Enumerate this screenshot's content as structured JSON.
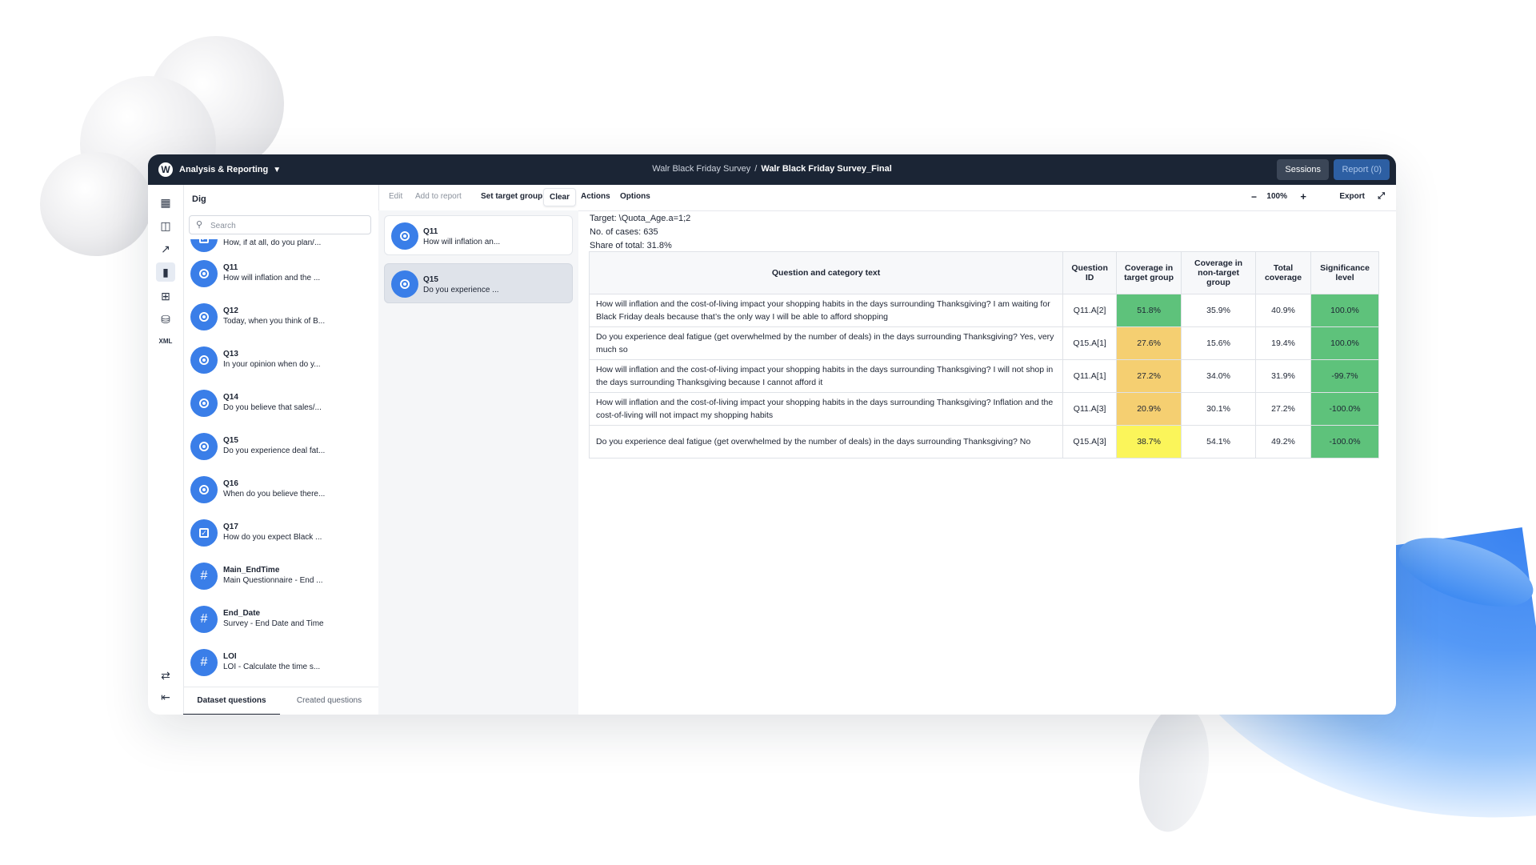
{
  "colors": {
    "topbar_bg": "#1b2535",
    "accent_blue": "#3a7ee8",
    "green": "#5ec27b",
    "orange": "#f5cf71",
    "yellow": "#fbf55a"
  },
  "header": {
    "app_title": "Analysis & Reporting",
    "breadcrumb_parent": "Walr Black Friday Survey",
    "breadcrumb_separator": "/",
    "breadcrumb_current": "Walr Black Friday Survey_Final",
    "sessions_label": "Sessions",
    "report_label": "Report (0)"
  },
  "rail_icons": [
    "table-icon",
    "layout-icon",
    "line-chart-icon",
    "bar-chart-icon",
    "grid-icon",
    "database-icon",
    "xml-icon",
    "automation-icon",
    "collapse-icon"
  ],
  "question_panel": {
    "title": "Dig",
    "search_placeholder": "Search",
    "items": [
      {
        "name": "",
        "desc": "How, if at all, do you plan/...",
        "icon": "checkbox-icon"
      },
      {
        "name": "Q11",
        "desc": "How will inflation and the ...",
        "icon": "radio-icon"
      },
      {
        "name": "Q12",
        "desc": "Today, when you think of B...",
        "icon": "radio-icon"
      },
      {
        "name": "Q13",
        "desc": "In your opinion when do y...",
        "icon": "radio-icon"
      },
      {
        "name": "Q14",
        "desc": "Do you believe that sales/...",
        "icon": "radio-icon"
      },
      {
        "name": "Q15",
        "desc": "Do you experience deal fat...",
        "icon": "radio-icon"
      },
      {
        "name": "Q16",
        "desc": "When do you believe there...",
        "icon": "radio-icon"
      },
      {
        "name": "Q17",
        "desc": "How do you expect Black ...",
        "icon": "checkbox-icon"
      },
      {
        "name": "Main_EndTime",
        "desc": "Main Questionnaire - End ...",
        "icon": "hash-icon"
      },
      {
        "name": "End_Date",
        "desc": "Survey - End Date and Time",
        "icon": "hash-icon"
      },
      {
        "name": "LOI",
        "desc": "LOI - Calculate the time s...",
        "icon": "hash-icon"
      }
    ],
    "tabs": [
      "Dataset questions",
      "Created questions"
    ]
  },
  "toolbar": {
    "edit": "Edit",
    "add_to_report": "Add to report",
    "set_target_group": "Set target group",
    "clear": "Clear",
    "actions": "Actions",
    "options": "Options",
    "zoom_minus": "−",
    "zoom": "100%",
    "zoom_plus": "+",
    "export": "Export"
  },
  "selected_questions": [
    {
      "name": "Q11",
      "desc": "How will inflation an..."
    },
    {
      "name": "Q15",
      "desc": "Do you experience ..."
    }
  ],
  "results": {
    "target": "Target: \\Quota_Age.a=1;2",
    "cases": "No. of cases: 635",
    "share": "Share of total: 31.8%",
    "headers": [
      "Question and category text",
      "Question ID",
      "Coverage in target group",
      "Coverage in non-target group",
      "Total coverage",
      "Significance level"
    ],
    "rows": [
      {
        "text": "How will inflation and the cost-of-living impact your shopping habits in the days surrounding Thanksgiving? I am waiting for Black Friday deals because that’s the only way I will be able to afford shopping",
        "id": "Q11.A[2]",
        "target": "51.8%",
        "target_color": "green",
        "nontarget": "35.9%",
        "total": "40.9%",
        "sig": "100.0%",
        "sig_color": "green"
      },
      {
        "text": "Do you experience deal fatigue (get overwhelmed by the number of deals) in the days surrounding Thanksgiving? Yes, very much so",
        "id": "Q15.A[1]",
        "target": "27.6%",
        "target_color": "orange",
        "nontarget": "15.6%",
        "total": "19.4%",
        "sig": "100.0%",
        "sig_color": "green"
      },
      {
        "text": "How will inflation and the cost-of-living impact your shopping habits in the days surrounding Thanksgiving? I will not shop in the days surrounding Thanksgiving because I cannot afford it",
        "id": "Q11.A[1]",
        "target": "27.2%",
        "target_color": "orange",
        "nontarget": "34.0%",
        "total": "31.9%",
        "sig": "-99.7%",
        "sig_color": "green"
      },
      {
        "text": "How will inflation and the cost-of-living impact your shopping habits in the days surrounding Thanksgiving? Inflation and the cost-of-living will not impact my shopping habits",
        "id": "Q11.A[3]",
        "target": "20.9%",
        "target_color": "orange",
        "nontarget": "30.1%",
        "total": "27.2%",
        "sig": "-100.0%",
        "sig_color": "green"
      },
      {
        "text": "Do you experience deal fatigue (get overwhelmed by the number of deals) in the days surrounding Thanksgiving? No",
        "id": "Q15.A[3]",
        "target": "38.7%",
        "target_color": "yellow",
        "nontarget": "54.1%",
        "total": "49.2%",
        "sig": "-100.0%",
        "sig_color": "green"
      }
    ]
  }
}
